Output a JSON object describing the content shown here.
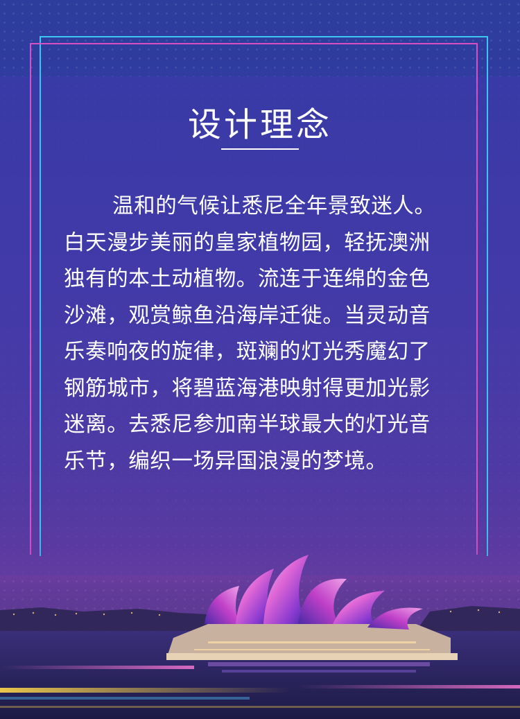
{
  "title": "设计理念",
  "paragraph_lines": [
    "温和的气候让悉尼全年景致迷人。",
    "白天漫步美丽的皇家植物园，轻抚澳洲",
    "独有的本土动植物。流连于连绵的金色",
    "沙滩，观赏鲸鱼沿海岸迁徙。当灵动音",
    "乐奏响夜的旋律，斑斓的灯光秀魔幻了",
    "钢筋城市，将碧蓝海港映射得更加光影",
    "迷离。去悉尼参加南半球最大的灯光音",
    "乐节，编织一场异国浪漫的梦境。"
  ],
  "colors": {
    "frame_pink": "#d94fc4",
    "frame_cyan": "#39c6f0",
    "text": "#ffffff"
  }
}
